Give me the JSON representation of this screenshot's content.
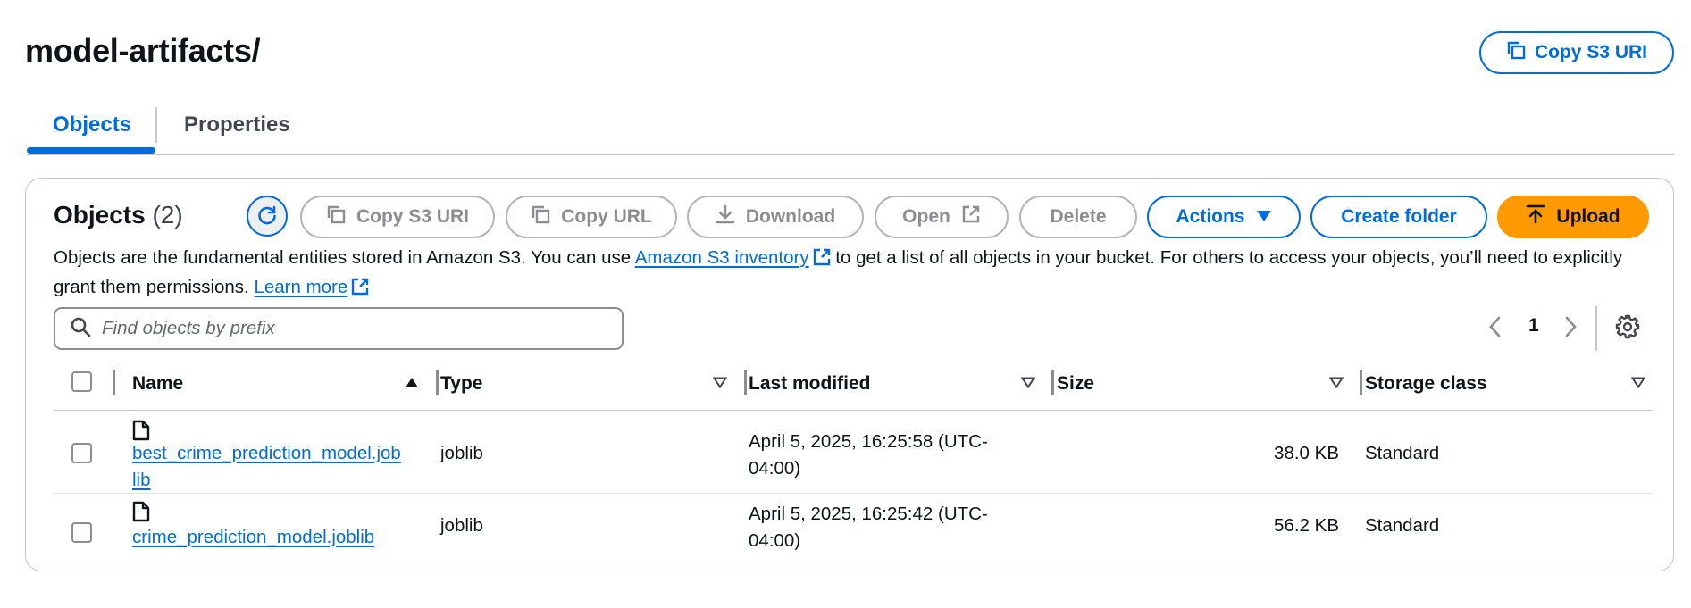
{
  "header": {
    "title": "model-artifacts/",
    "copy_s3_uri_label": "Copy S3 URI"
  },
  "tabs": [
    {
      "label": "Objects",
      "active": true
    },
    {
      "label": "Properties",
      "active": false
    }
  ],
  "objects_panel": {
    "heading": "Objects",
    "count": "(2)",
    "toolbar": {
      "copy_s3_uri": "Copy S3 URI",
      "copy_url": "Copy URL",
      "download": "Download",
      "open": "Open",
      "delete": "Delete",
      "actions": "Actions",
      "create_folder": "Create folder",
      "upload": "Upload"
    },
    "description": {
      "part1": "Objects are the fundamental entities stored in Amazon S3. You can use ",
      "inventory_link": "Amazon S3 inventory",
      "part2": " to get a list of all objects in your bucket. For others to access your objects, you’ll need to explicitly grant them permissions. ",
      "learn_more_link": "Learn more"
    },
    "search": {
      "placeholder": "Find objects by prefix",
      "value": ""
    },
    "pagination": {
      "current_page": "1"
    },
    "table": {
      "columns": [
        "Name",
        "Type",
        "Last modified",
        "Size",
        "Storage class"
      ],
      "rows": [
        {
          "name": "best_crime_prediction_model.joblib",
          "type": "joblib",
          "last_modified": "April 5, 2025, 16:25:58 (UTC-04:00)",
          "size": "38.0 KB",
          "storage_class": "Standard"
        },
        {
          "name": "crime_prediction_model.joblib",
          "type": "joblib",
          "last_modified": "April 5, 2025, 16:25:42 (UTC-04:00)",
          "size": "56.2 KB",
          "storage_class": "Standard"
        }
      ]
    }
  },
  "colors": {
    "link_blue": "#006ce0",
    "upload_orange": "#ff9900",
    "disabled_gray": "#8c8c94"
  }
}
